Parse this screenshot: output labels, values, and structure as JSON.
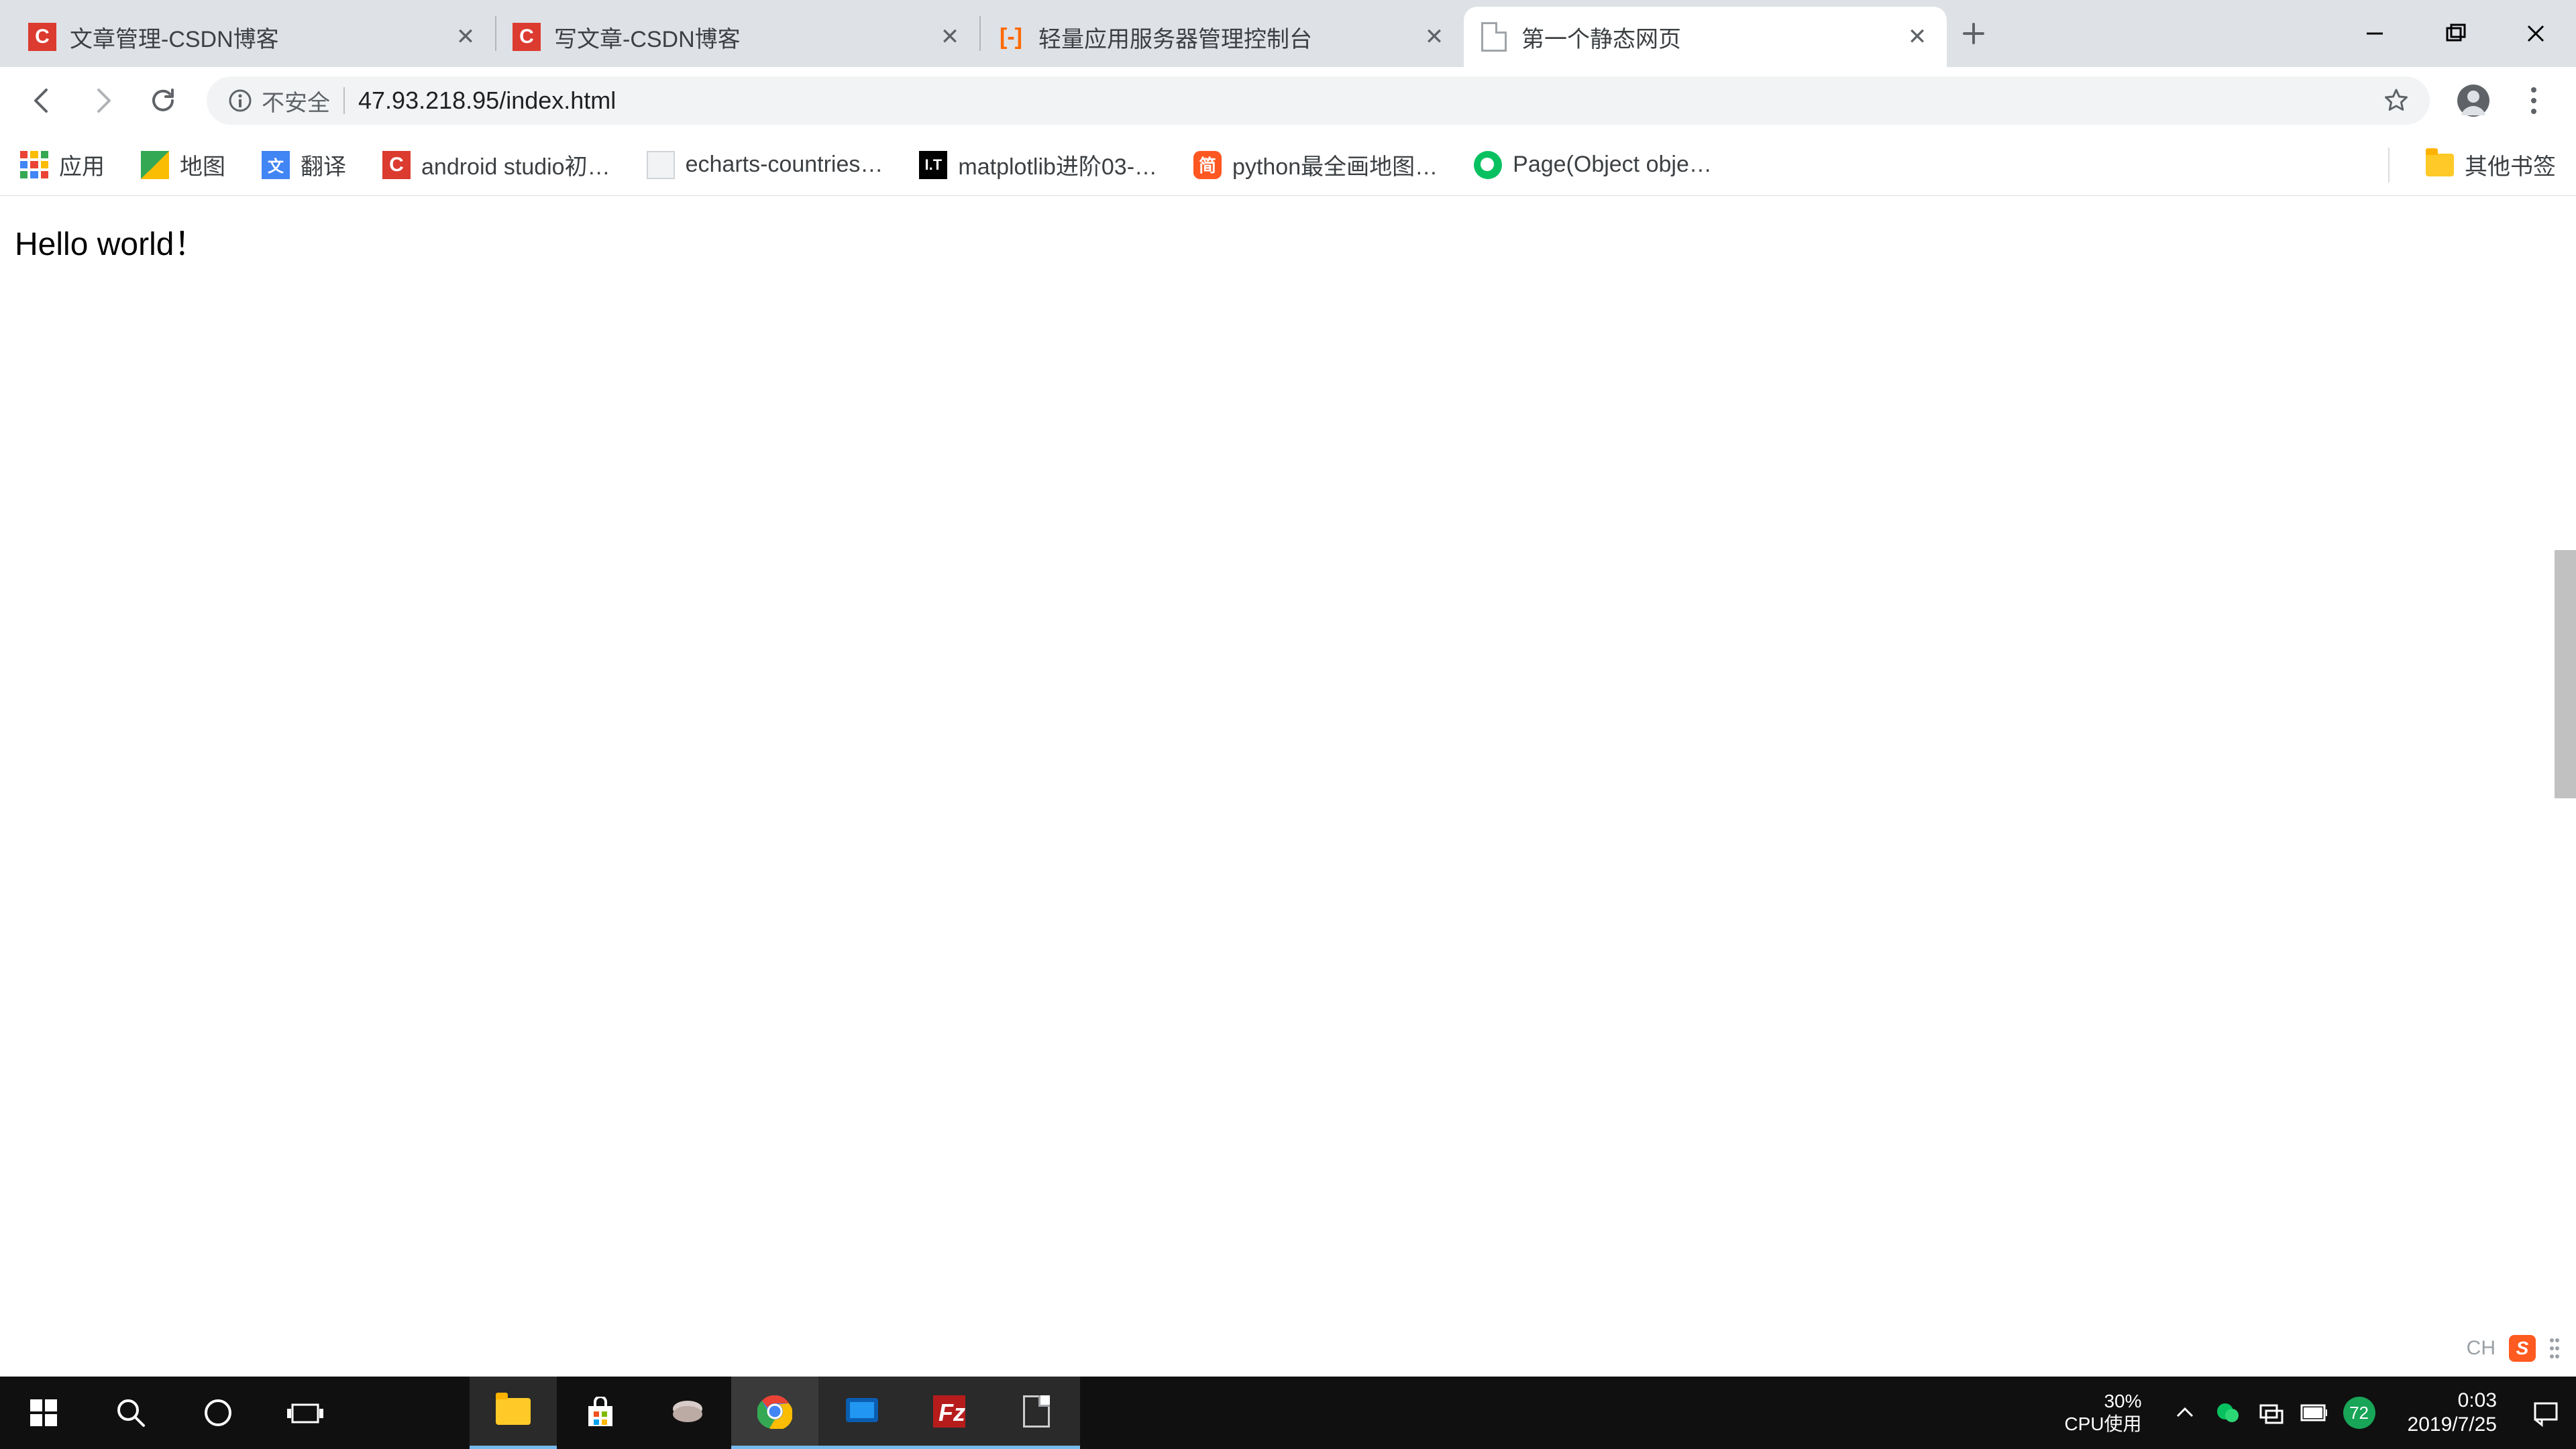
{
  "tabs": [
    {
      "title": "文章管理-CSDN博客",
      "favicon": "csdn",
      "active": false
    },
    {
      "title": "写文章-CSDN博客",
      "favicon": "csdn",
      "active": false
    },
    {
      "title": "轻量应用服务器管理控制台",
      "favicon": "aliyun",
      "active": false
    },
    {
      "title": "第一个静态网页",
      "favicon": "doc",
      "active": true
    }
  ],
  "omnibox": {
    "security_label": "不安全",
    "url": "47.93.218.95/index.html"
  },
  "bookmarks": [
    {
      "icon": "apps",
      "label": "应用"
    },
    {
      "icon": "maps",
      "label": "地图"
    },
    {
      "icon": "translate",
      "label": "翻译"
    },
    {
      "icon": "csdn",
      "label": "android studio初…"
    },
    {
      "icon": "cube",
      "label": "echarts-countries…"
    },
    {
      "icon": "it",
      "label": "matplotlib进阶03-…"
    },
    {
      "icon": "jian",
      "label": "python最全画地图…"
    },
    {
      "icon": "wechat",
      "label": "Page(Object obje…"
    }
  ],
  "bookmarks_right": {
    "icon": "folder",
    "label": "其他书签"
  },
  "page": {
    "body_text": "Hello world！"
  },
  "browser_overlay": {
    "ime": "CH",
    "sogou": "S"
  },
  "taskbar": {
    "cpu_pct": "30%",
    "cpu_label": "CPU使用",
    "temp_badge": "72",
    "clock_time": "0:03",
    "clock_date": "2019/7/25"
  }
}
